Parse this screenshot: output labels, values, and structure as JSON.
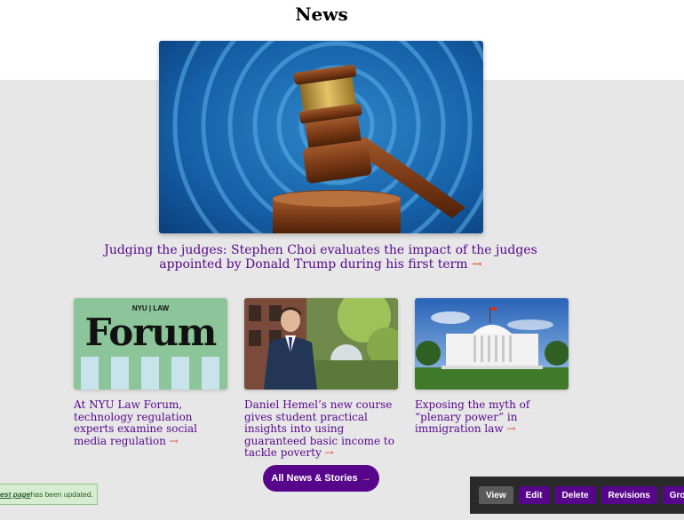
{
  "page": {
    "title": "News"
  },
  "feature": {
    "image_alt": "Judge's gavel",
    "caption": "Judging the judges: Stephen Choi evaluates the impact of the judges appointed by Donald Trump during his first term",
    "arrow": "→"
  },
  "cards": [
    {
      "logo_small": "NYU | LAW",
      "logo_big": "Forum",
      "caption": "At NYU Law Forum, technology regulation experts examine social media regulation",
      "arrow": "→"
    },
    {
      "caption": "Daniel Hemel’s new course gives student practical insights into using guaranteed basic income to tackle poverty",
      "arrow": "→"
    },
    {
      "caption": "Exposing the myth of “plenary power” in immigration law",
      "arrow": "→"
    }
  ],
  "all_news": {
    "label": "All News & Stories",
    "arrow": "→"
  },
  "status": {
    "link": "est page",
    "text": " has been updated."
  },
  "admin": {
    "tabs": [
      "View",
      "Edit",
      "Delete",
      "Revisions",
      "Group"
    ]
  },
  "colors": {
    "brand_purple": "#57068c",
    "accent_arrow": "#e0533a",
    "band_gray": "#e7e7e7"
  }
}
